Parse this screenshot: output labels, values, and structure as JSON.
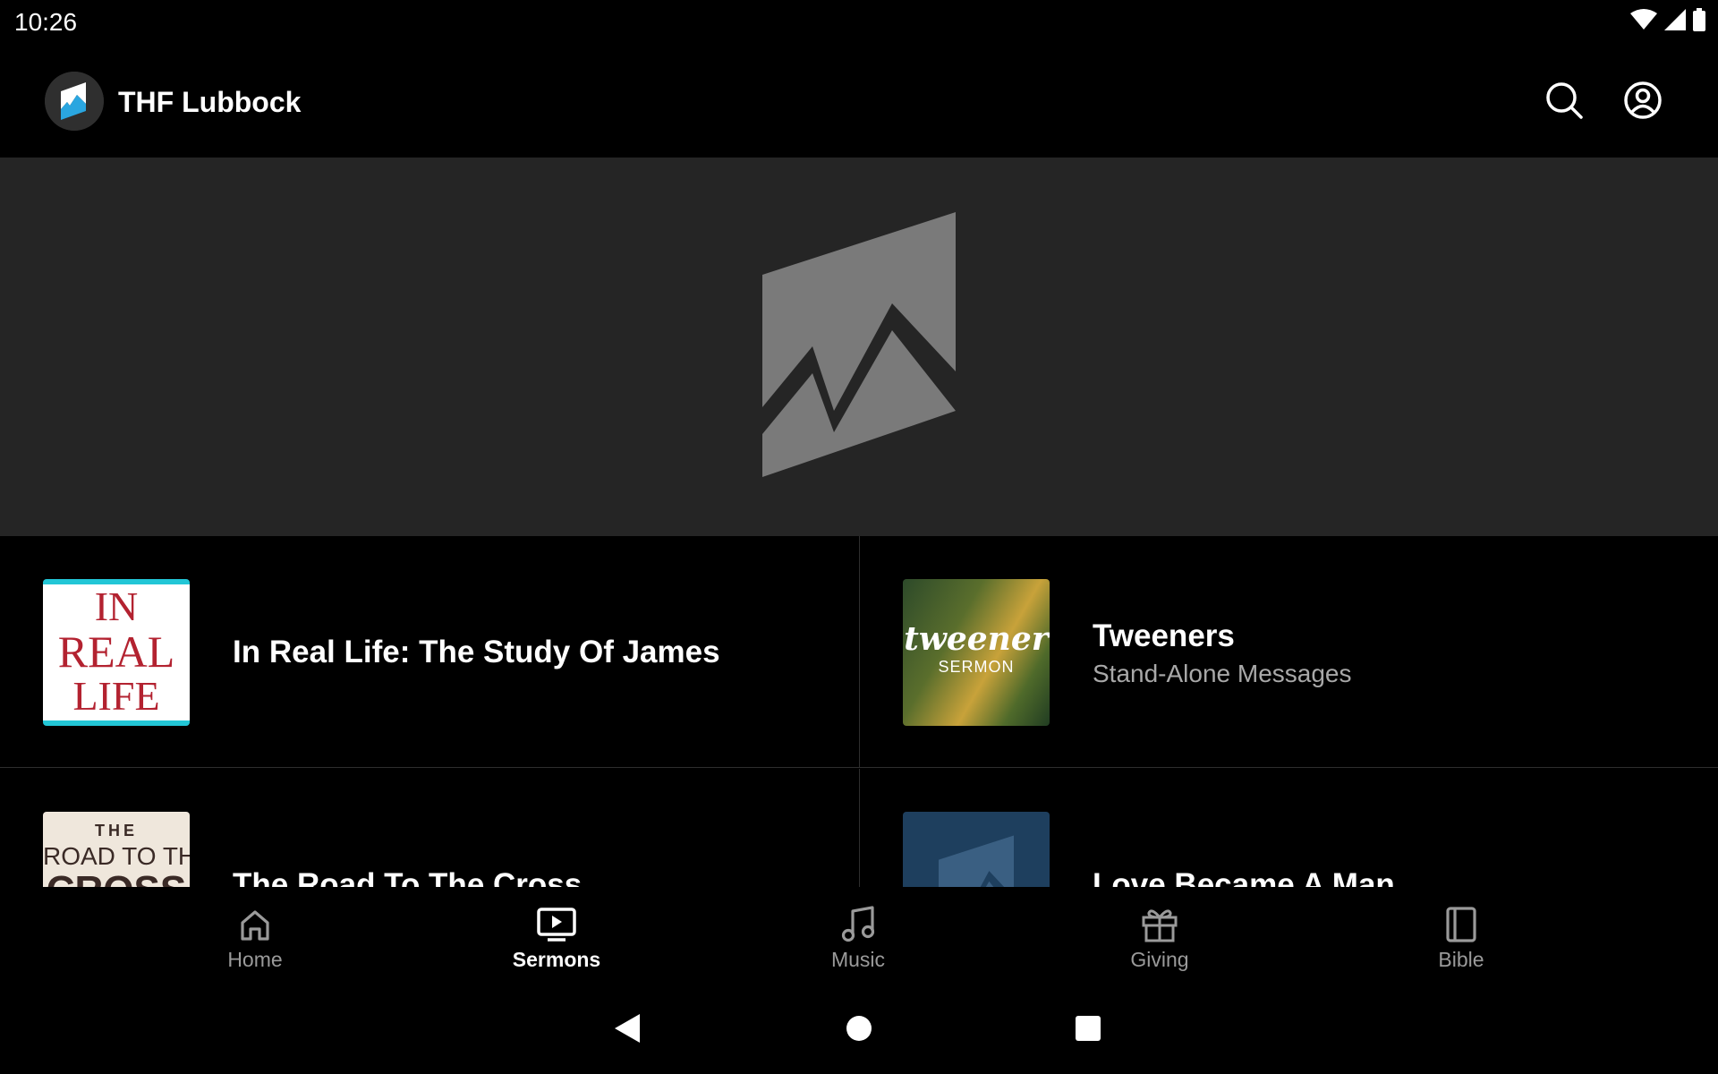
{
  "status_bar": {
    "time": "10:26",
    "icons": [
      "wifi-icon",
      "signal-icon",
      "battery-icon"
    ]
  },
  "app_bar": {
    "title": "THF Lubbock",
    "actions": [
      "search-icon",
      "account-icon"
    ]
  },
  "hero": {
    "icon": "church-logo-placeholder-icon"
  },
  "series": [
    {
      "title": "In Real Life: The Study Of James",
      "subtitle": "",
      "thumb_text": [
        "IN",
        "REAL",
        "LIFE"
      ]
    },
    {
      "title": "Tweeners",
      "subtitle": "Stand-Alone Messages",
      "thumb_text": [
        "tweener",
        "SERMON"
      ]
    },
    {
      "title": "The Road To The Cross",
      "subtitle": "",
      "thumb_text": [
        "THE",
        "ROAD TO THE",
        "CROSS"
      ]
    },
    {
      "title": "Love Became A Man",
      "subtitle": "",
      "thumb_text": []
    }
  ],
  "bottom_nav": {
    "items": [
      {
        "label": "Home",
        "icon": "home-icon",
        "active": false
      },
      {
        "label": "Sermons",
        "icon": "video-play-icon",
        "active": true
      },
      {
        "label": "Music",
        "icon": "music-note-icon",
        "active": false
      },
      {
        "label": "Giving",
        "icon": "gift-icon",
        "active": false
      },
      {
        "label": "Bible",
        "icon": "book-icon",
        "active": false
      }
    ]
  },
  "system_nav": {
    "buttons": [
      "back-icon",
      "home-circle-icon",
      "recents-icon"
    ]
  },
  "colors": {
    "background": "#000000",
    "hero_background": "#252525",
    "logo_blue": "#2aa6e0",
    "inactive_label": "#9a9a9a",
    "subtitle": "#a8a8a8"
  }
}
